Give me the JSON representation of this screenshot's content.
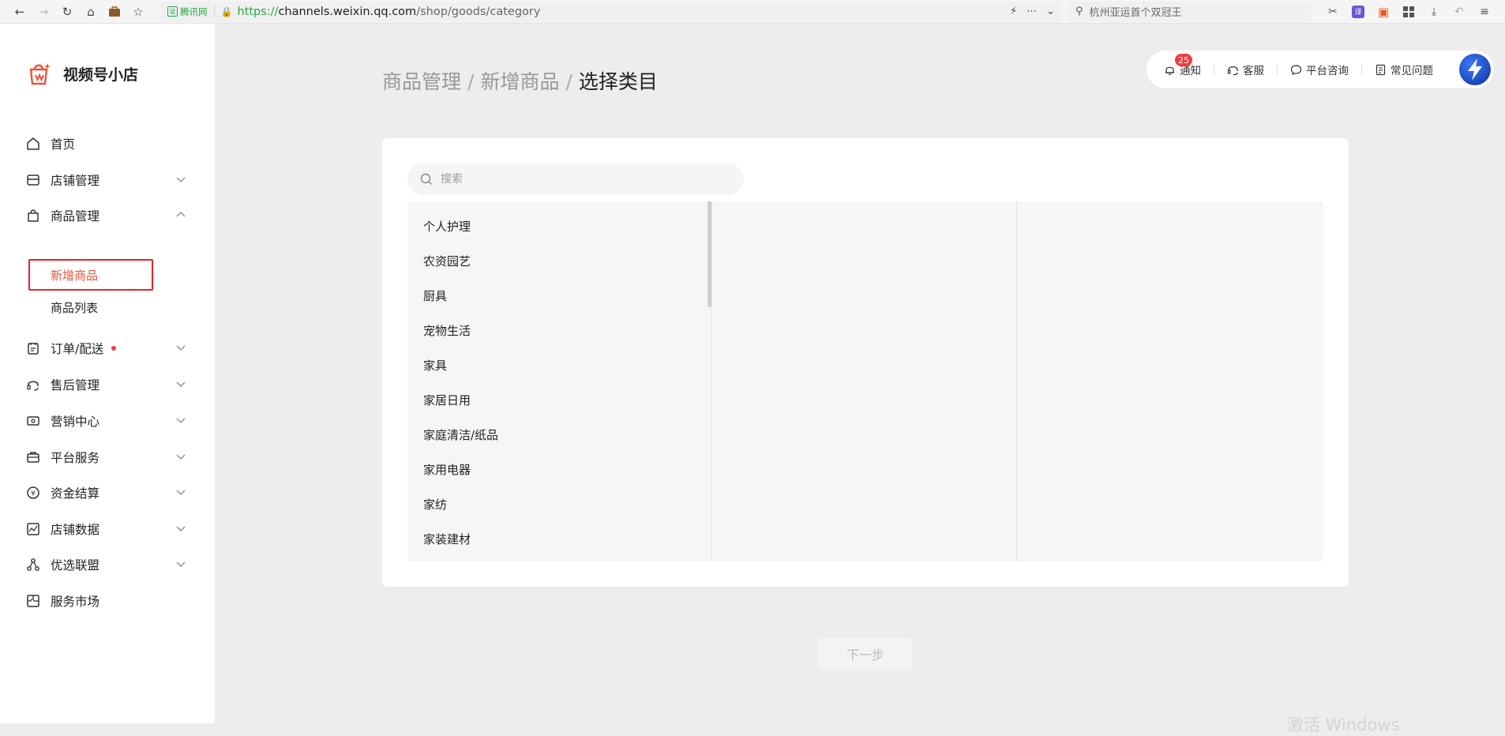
{
  "browser": {
    "cert_label": "腾讯网",
    "url_protocol": "https://",
    "url_host": "channels.weixin.qq.com",
    "url_path": "/shop/goods/category",
    "search_text": "杭州亚运首个双冠王"
  },
  "sidebar": {
    "brand_name": "视频号小店",
    "items": [
      {
        "label": "首页",
        "icon": "home-icon"
      },
      {
        "label": "店铺管理",
        "icon": "store-icon"
      },
      {
        "label": "商品管理",
        "icon": "bag-icon"
      },
      {
        "label": "订单/配送",
        "icon": "clipboard-icon"
      },
      {
        "label": "售后管理",
        "icon": "headset-icon"
      },
      {
        "label": "营销中心",
        "icon": "ticket-icon"
      },
      {
        "label": "平台服务",
        "icon": "briefcase-icon"
      },
      {
        "label": "资金结算",
        "icon": "yen-icon"
      },
      {
        "label": "店铺数据",
        "icon": "chart-icon"
      },
      {
        "label": "优选联盟",
        "icon": "network-icon"
      },
      {
        "label": "服务市场",
        "icon": "puzzle-icon"
      }
    ],
    "sub_items": [
      {
        "label": "新增商品"
      },
      {
        "label": "商品列表"
      }
    ]
  },
  "breadcrumb": {
    "part1": "商品管理",
    "part2": "新增商品",
    "current": "选择类目",
    "separator": "/"
  },
  "topbar": {
    "notify_label": "通知",
    "notify_count": "25",
    "service_label": "客服",
    "consult_label": "平台咨询",
    "faq_label": "常见问题"
  },
  "search": {
    "placeholder": "搜索"
  },
  "categories": [
    "个人护理",
    "农资园艺",
    "厨具",
    "宠物生活",
    "家具",
    "家居日用",
    "家庭清洁/纸品",
    "家用电器",
    "家纺",
    "家装建材"
  ],
  "next_button": "下一步",
  "watermark": "激活 Windows",
  "colors": {
    "accent": "#e8533f",
    "highlight_box": "#e8202a",
    "secure": "#27a543",
    "badge": "#ee3d3d"
  }
}
